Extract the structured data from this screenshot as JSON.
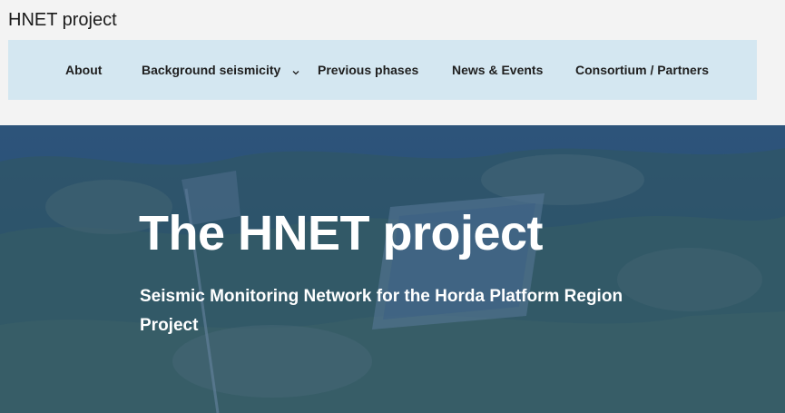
{
  "header": {
    "site_title": "HNET project"
  },
  "nav": {
    "items": [
      {
        "label": "About"
      },
      {
        "label": "Background seismicity",
        "has_dropdown": true
      },
      {
        "label": "Previous phases"
      },
      {
        "label": "News & Events"
      },
      {
        "label": "Consortium / Partners"
      }
    ]
  },
  "hero": {
    "title": "The HNET project",
    "subtitle": "Seismic Monitoring Network for the Horda Platform Region Project"
  },
  "colors": {
    "nav_background": "#d4e7f1",
    "hero_overlay": "#164270",
    "page_background": "#f3f3f3"
  },
  "icons": {
    "dropdown": "chevron-down-icon"
  }
}
